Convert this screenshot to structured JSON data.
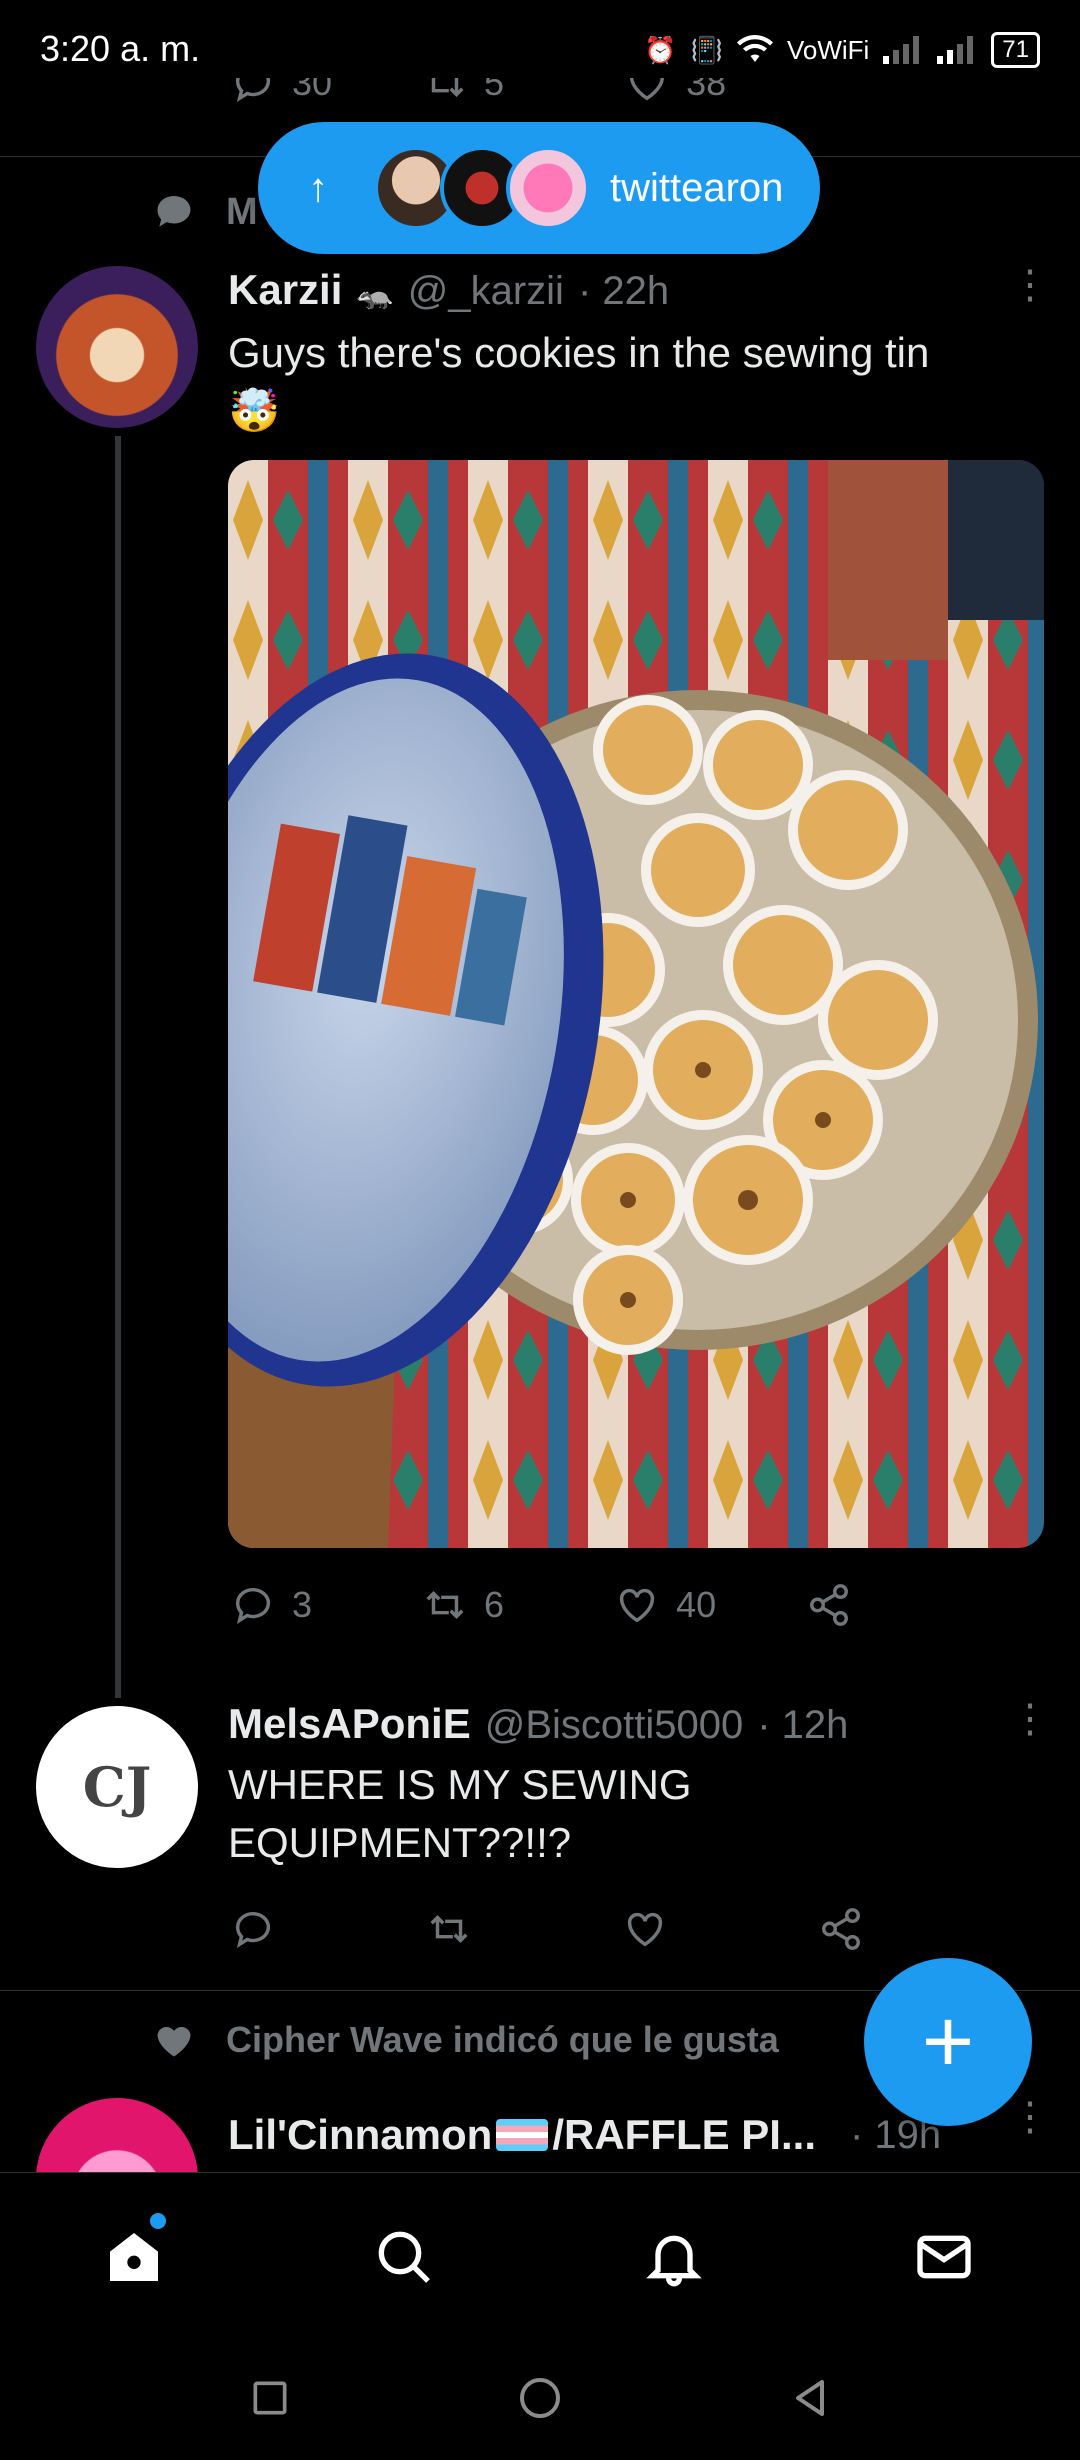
{
  "status_bar": {
    "time": "3:20 a. m.",
    "network": "VoWiFi",
    "battery": "71"
  },
  "prev_tweet": {
    "replies": "30",
    "retweets": "5",
    "likes": "38",
    "social_prefix": "M"
  },
  "pill": {
    "label": "twittearon"
  },
  "tweet1": {
    "name": "Karzii",
    "handle": "@_karzii",
    "time": "· 22h",
    "text": "Guys there's cookies in the sewing tin",
    "emoji": "🤯",
    "replies": "3",
    "retweets": "6",
    "likes": "40"
  },
  "tweet2": {
    "name": "MelsAPoniE",
    "handle": "@Biscotti5000",
    "time": "· 12h",
    "text": "WHERE IS MY SEWING EQUIPMENT??!!?"
  },
  "social_context": {
    "text": "Cipher Wave indicó que le gusta"
  },
  "tweet3": {
    "name": "Lil'Cinnamon",
    "name_suffix": "/RAFFLE PI...",
    "time": "· 19h"
  },
  "colors": {
    "accent": "#1d9bf0",
    "background": "#000000",
    "muted": "#71767b"
  }
}
